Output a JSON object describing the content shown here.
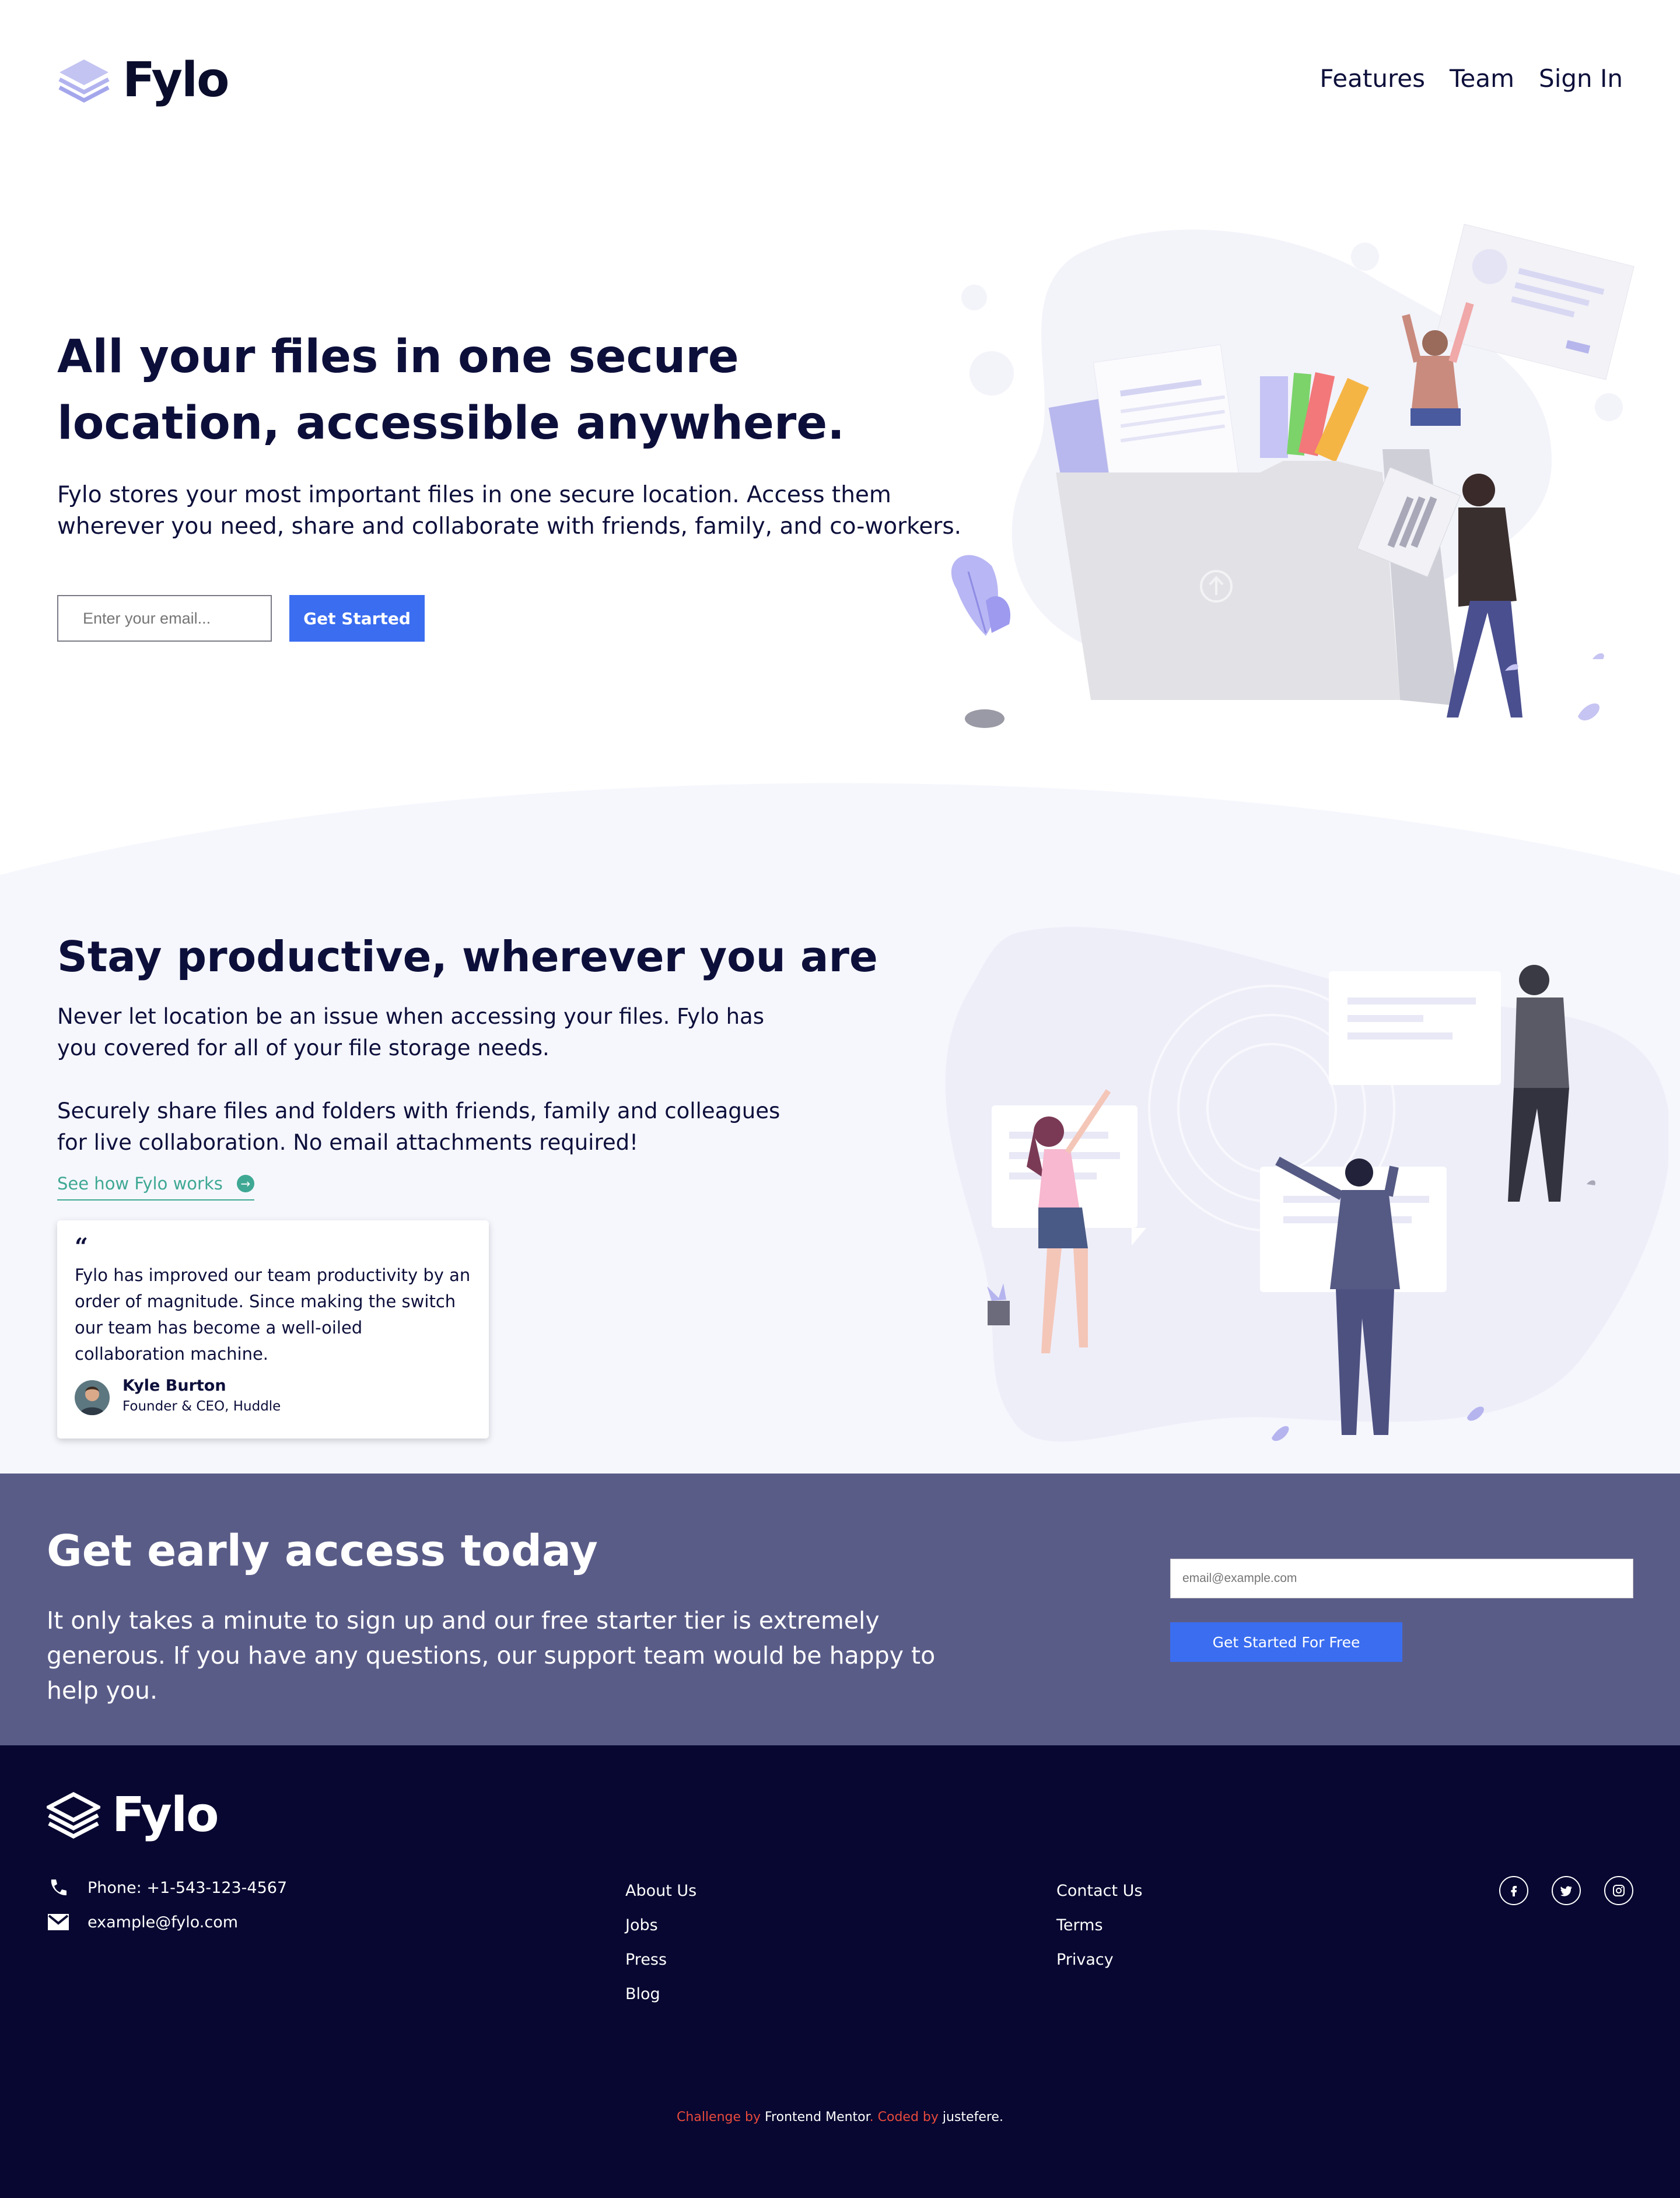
{
  "header": {
    "brand": "Fylo",
    "nav": [
      {
        "label": "Features"
      },
      {
        "label": "Team"
      },
      {
        "label": "Sign In"
      }
    ]
  },
  "hero": {
    "title": "All your files in one secure location, accessible anywhere.",
    "description": "Fylo stores your most important files in one secure location. Access them wherever you need, share and collaborate with friends, family, and co-workers.",
    "email_placeholder": "Enter your email...",
    "cta_label": "Get Started"
  },
  "productive": {
    "title": "Stay productive, wherever you are",
    "paragraph_1": "Never let location be an issue when accessing your files. Fylo has you covered for all of your file storage needs.",
    "paragraph_2": "Securely share files and folders with friends, family and colleagues for live collaboration. No email attachments required!",
    "link_label": "See how Fylo works",
    "testimonial": {
      "quote_mark": "“",
      "quote": "Fylo has improved our team productivity by an order of magnitude. Since making the switch our team has become a well-oiled collaboration machine.",
      "author_name": "Kyle Burton",
      "author_title": "Founder & CEO, Huddle"
    }
  },
  "early_access": {
    "title": "Get early access today",
    "description": "It only takes a minute to sign up and our free starter tier is extremely generous. If you have any questions, our support team would be happy to help you.",
    "email_placeholder": "email@example.com",
    "cta_label": "Get Started For Free"
  },
  "footer": {
    "brand": "Fylo",
    "phone": "Phone: +1-543-123-4567",
    "email": "example@fylo.com",
    "column_1": [
      "About Us",
      "Jobs",
      "Press",
      "Blog"
    ],
    "column_2": [
      "Contact Us",
      "Terms",
      "Privacy"
    ],
    "socials": [
      {
        "icon": "facebook-icon",
        "glyph": "f"
      },
      {
        "icon": "twitter-icon",
        "glyph": "t"
      },
      {
        "icon": "instagram-icon",
        "glyph": "o"
      }
    ],
    "credits": {
      "challenge_by": "Challenge by ",
      "frontend_mentor": "Frontend Mentor",
      "coded_by": ". Coded by ",
      "author": "justefere",
      "end": "."
    }
  },
  "colors": {
    "navy": "#0d0f3b",
    "accent_blue": "#3a6df0",
    "teal": "#3fa894",
    "early_bg": "#5a5c88",
    "footer_bg": "#070731",
    "section_bg": "#f6f7fd"
  }
}
